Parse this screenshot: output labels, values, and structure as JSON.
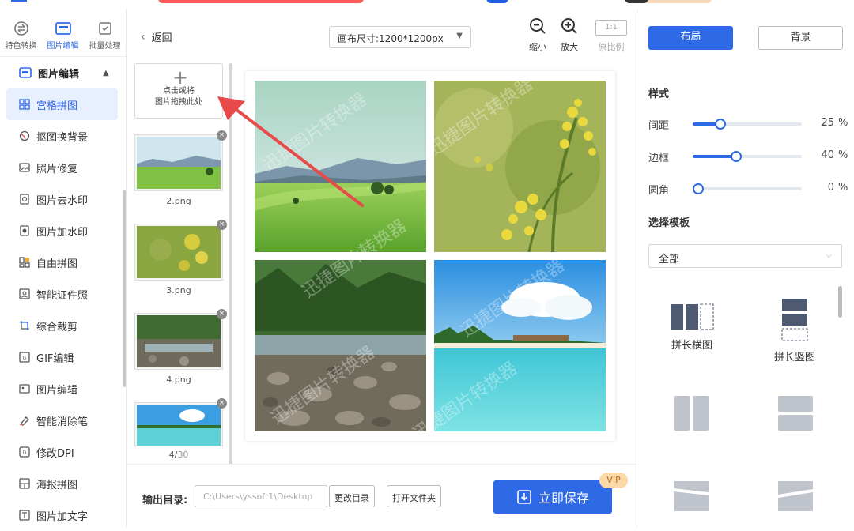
{
  "sidebar": {
    "top_tabs": [
      {
        "label": "特色转换"
      },
      {
        "label": "图片编辑"
      },
      {
        "label": "批量处理"
      }
    ],
    "section_title": "图片编辑",
    "items": [
      {
        "label": "宫格拼图"
      },
      {
        "label": "抠图换背景"
      },
      {
        "label": "照片修复"
      },
      {
        "label": "图片去水印"
      },
      {
        "label": "图片加水印"
      },
      {
        "label": "自由拼图"
      },
      {
        "label": "智能证件照"
      },
      {
        "label": "综合裁剪"
      },
      {
        "label": "GIF编辑"
      },
      {
        "label": "图片编辑"
      },
      {
        "label": "智能消除笔"
      },
      {
        "label": "修改DPI"
      },
      {
        "label": "海报拼图"
      },
      {
        "label": "图片加文字"
      }
    ]
  },
  "thumbs": {
    "back_label": "返回",
    "add_line1": "点击或将",
    "add_line2": "图片拖拽此处",
    "files": [
      {
        "name": "2.png"
      },
      {
        "name": "3.png"
      },
      {
        "name": "4.png"
      }
    ],
    "count_current": "4/",
    "count_total": "30"
  },
  "toolbar": {
    "canvas_size": "画布尺寸:1200*1200px",
    "zoom_out": "缩小",
    "zoom_in": "放大",
    "ratio_box": "1:1",
    "ratio_label": "原比例"
  },
  "watermark": "迅捷图片转换器",
  "bottom": {
    "output_label": "输出目录:",
    "output_path": "C:\\Users\\yssoft1\\Desktop",
    "change_dir": "更改目录",
    "open_folder": "打开文件夹",
    "save": "立即保存",
    "vip": "VIP"
  },
  "right": {
    "tab_layout": "布局",
    "tab_background": "背景",
    "style_title": "样式",
    "sliders": [
      {
        "label": "间距",
        "value": "25",
        "unit": "%",
        "fraction": 0.25
      },
      {
        "label": "边框",
        "value": "40",
        "unit": "%",
        "fraction": 0.4
      },
      {
        "label": "圆角",
        "value": "0",
        "unit": "%",
        "fraction": 0
      }
    ],
    "template_title": "选择模板",
    "template_filter": "全部",
    "templates": [
      {
        "label": "拼长横图"
      },
      {
        "label": "拼长竖图"
      }
    ]
  },
  "colors": {
    "accent": "#2f6ae6",
    "arrow": "#e84a4a",
    "vip_bg": "#fcd9a8"
  }
}
